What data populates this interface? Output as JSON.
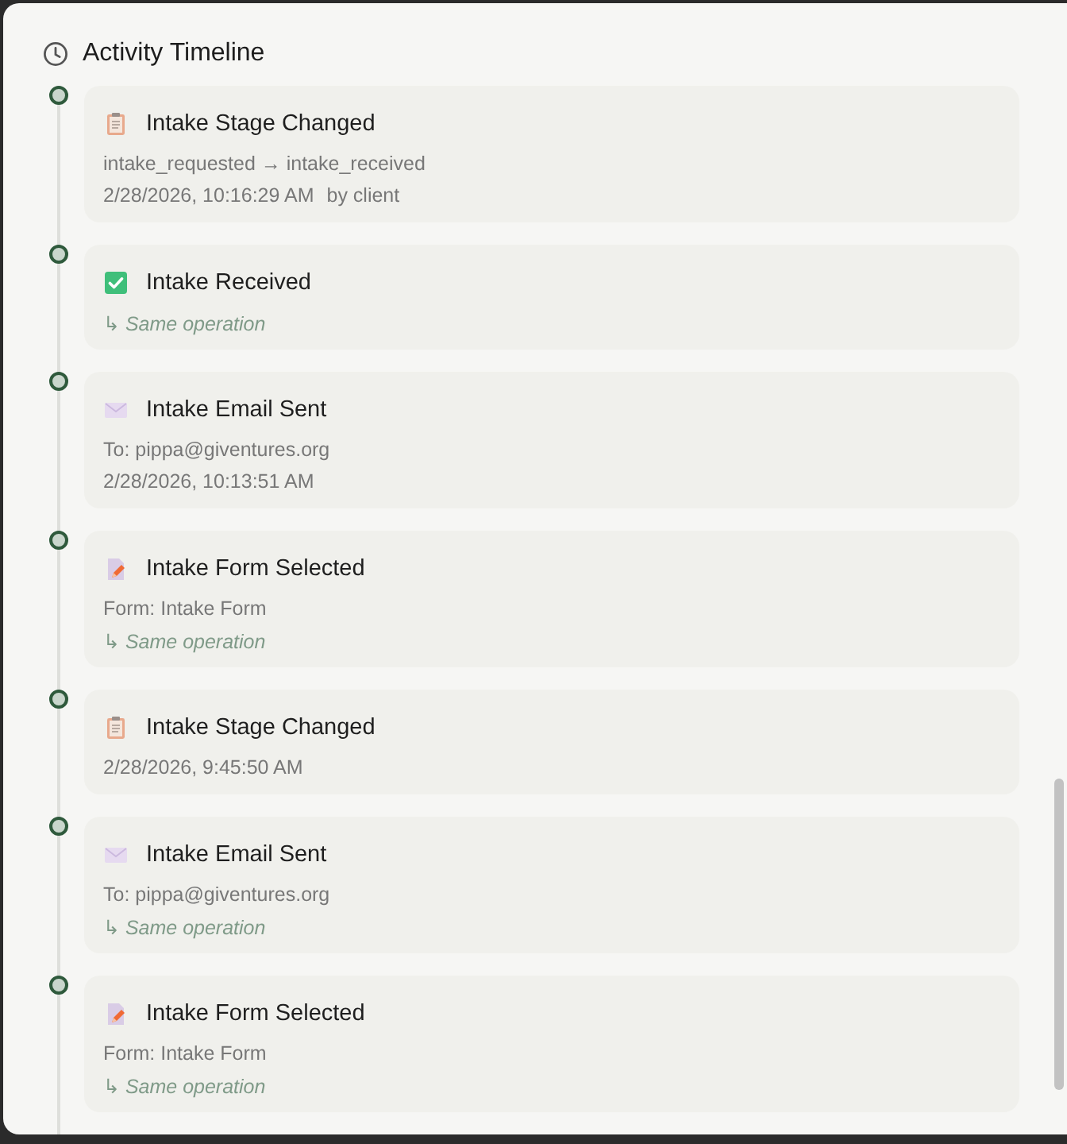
{
  "panel": {
    "title": "Activity Timeline"
  },
  "events": [
    {
      "kind": "stage",
      "title": "Intake Stage Changed",
      "details": [
        {
          "kind": "text",
          "text": "intake_requested → intake_received"
        },
        {
          "kind": "meta",
          "text": "2/28/2026, 10:16:29 AM",
          "actor": "by client"
        }
      ]
    },
    {
      "kind": "received",
      "title": "Intake Received",
      "details": [
        {
          "kind": "note",
          "text": "↳ Same operation"
        }
      ]
    },
    {
      "kind": "email",
      "title": "Intake Email Sent",
      "details": [
        {
          "kind": "text",
          "text": "To: pippa@giventures.org"
        },
        {
          "kind": "meta",
          "text": "2/28/2026, 10:13:51 AM"
        }
      ]
    },
    {
      "kind": "form",
      "title": "Intake Form Selected",
      "details": [
        {
          "kind": "text",
          "text": "Form: Intake Form"
        },
        {
          "kind": "note",
          "text": "↳ Same operation"
        }
      ]
    },
    {
      "kind": "stage",
      "title": "Intake Stage Changed",
      "details": [
        {
          "kind": "meta",
          "text": "2/28/2026, 9:45:50 AM"
        }
      ]
    },
    {
      "kind": "email",
      "title": "Intake Email Sent",
      "details": [
        {
          "kind": "text",
          "text": "To: pippa@giventures.org"
        },
        {
          "kind": "note",
          "text": "↳ Same operation"
        }
      ]
    },
    {
      "kind": "form",
      "title": "Intake Form Selected",
      "details": [
        {
          "kind": "text",
          "text": "Form: Intake Form"
        },
        {
          "kind": "note",
          "text": "↳ Same operation"
        }
      ]
    }
  ]
}
